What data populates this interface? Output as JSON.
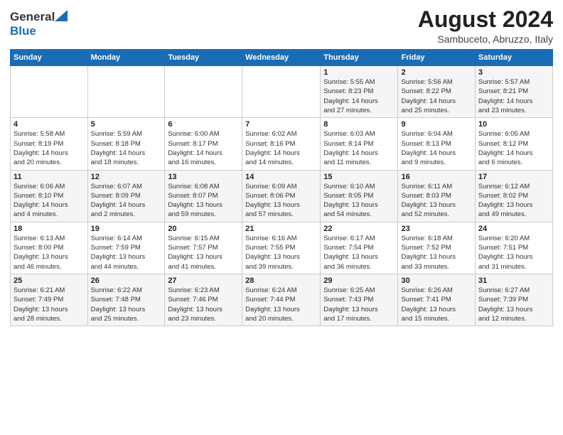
{
  "header": {
    "logo_line1": "General",
    "logo_line2": "Blue",
    "month_year": "August 2024",
    "location": "Sambuceto, Abruzzo, Italy"
  },
  "days_of_week": [
    "Sunday",
    "Monday",
    "Tuesday",
    "Wednesday",
    "Thursday",
    "Friday",
    "Saturday"
  ],
  "weeks": [
    [
      {
        "day": "",
        "info": ""
      },
      {
        "day": "",
        "info": ""
      },
      {
        "day": "",
        "info": ""
      },
      {
        "day": "",
        "info": ""
      },
      {
        "day": "1",
        "info": "Sunrise: 5:55 AM\nSunset: 8:23 PM\nDaylight: 14 hours\nand 27 minutes."
      },
      {
        "day": "2",
        "info": "Sunrise: 5:56 AM\nSunset: 8:22 PM\nDaylight: 14 hours\nand 25 minutes."
      },
      {
        "day": "3",
        "info": "Sunrise: 5:57 AM\nSunset: 8:21 PM\nDaylight: 14 hours\nand 23 minutes."
      }
    ],
    [
      {
        "day": "4",
        "info": "Sunrise: 5:58 AM\nSunset: 8:19 PM\nDaylight: 14 hours\nand 20 minutes."
      },
      {
        "day": "5",
        "info": "Sunrise: 5:59 AM\nSunset: 8:18 PM\nDaylight: 14 hours\nand 18 minutes."
      },
      {
        "day": "6",
        "info": "Sunrise: 6:00 AM\nSunset: 8:17 PM\nDaylight: 14 hours\nand 16 minutes."
      },
      {
        "day": "7",
        "info": "Sunrise: 6:02 AM\nSunset: 8:16 PM\nDaylight: 14 hours\nand 14 minutes."
      },
      {
        "day": "8",
        "info": "Sunrise: 6:03 AM\nSunset: 8:14 PM\nDaylight: 14 hours\nand 11 minutes."
      },
      {
        "day": "9",
        "info": "Sunrise: 6:04 AM\nSunset: 8:13 PM\nDaylight: 14 hours\nand 9 minutes."
      },
      {
        "day": "10",
        "info": "Sunrise: 6:05 AM\nSunset: 8:12 PM\nDaylight: 14 hours\nand 6 minutes."
      }
    ],
    [
      {
        "day": "11",
        "info": "Sunrise: 6:06 AM\nSunset: 8:10 PM\nDaylight: 14 hours\nand 4 minutes."
      },
      {
        "day": "12",
        "info": "Sunrise: 6:07 AM\nSunset: 8:09 PM\nDaylight: 14 hours\nand 2 minutes."
      },
      {
        "day": "13",
        "info": "Sunrise: 6:08 AM\nSunset: 8:07 PM\nDaylight: 13 hours\nand 59 minutes."
      },
      {
        "day": "14",
        "info": "Sunrise: 6:09 AM\nSunset: 8:06 PM\nDaylight: 13 hours\nand 57 minutes."
      },
      {
        "day": "15",
        "info": "Sunrise: 6:10 AM\nSunset: 8:05 PM\nDaylight: 13 hours\nand 54 minutes."
      },
      {
        "day": "16",
        "info": "Sunrise: 6:11 AM\nSunset: 8:03 PM\nDaylight: 13 hours\nand 52 minutes."
      },
      {
        "day": "17",
        "info": "Sunrise: 6:12 AM\nSunset: 8:02 PM\nDaylight: 13 hours\nand 49 minutes."
      }
    ],
    [
      {
        "day": "18",
        "info": "Sunrise: 6:13 AM\nSunset: 8:00 PM\nDaylight: 13 hours\nand 46 minutes."
      },
      {
        "day": "19",
        "info": "Sunrise: 6:14 AM\nSunset: 7:59 PM\nDaylight: 13 hours\nand 44 minutes."
      },
      {
        "day": "20",
        "info": "Sunrise: 6:15 AM\nSunset: 7:57 PM\nDaylight: 13 hours\nand 41 minutes."
      },
      {
        "day": "21",
        "info": "Sunrise: 6:16 AM\nSunset: 7:55 PM\nDaylight: 13 hours\nand 39 minutes."
      },
      {
        "day": "22",
        "info": "Sunrise: 6:17 AM\nSunset: 7:54 PM\nDaylight: 13 hours\nand 36 minutes."
      },
      {
        "day": "23",
        "info": "Sunrise: 6:18 AM\nSunset: 7:52 PM\nDaylight: 13 hours\nand 33 minutes."
      },
      {
        "day": "24",
        "info": "Sunrise: 6:20 AM\nSunset: 7:51 PM\nDaylight: 13 hours\nand 31 minutes."
      }
    ],
    [
      {
        "day": "25",
        "info": "Sunrise: 6:21 AM\nSunset: 7:49 PM\nDaylight: 13 hours\nand 28 minutes."
      },
      {
        "day": "26",
        "info": "Sunrise: 6:22 AM\nSunset: 7:48 PM\nDaylight: 13 hours\nand 25 minutes."
      },
      {
        "day": "27",
        "info": "Sunrise: 6:23 AM\nSunset: 7:46 PM\nDaylight: 13 hours\nand 23 minutes."
      },
      {
        "day": "28",
        "info": "Sunrise: 6:24 AM\nSunset: 7:44 PM\nDaylight: 13 hours\nand 20 minutes."
      },
      {
        "day": "29",
        "info": "Sunrise: 6:25 AM\nSunset: 7:43 PM\nDaylight: 13 hours\nand 17 minutes."
      },
      {
        "day": "30",
        "info": "Sunrise: 6:26 AM\nSunset: 7:41 PM\nDaylight: 13 hours\nand 15 minutes."
      },
      {
        "day": "31",
        "info": "Sunrise: 6:27 AM\nSunset: 7:39 PM\nDaylight: 13 hours\nand 12 minutes."
      }
    ]
  ]
}
